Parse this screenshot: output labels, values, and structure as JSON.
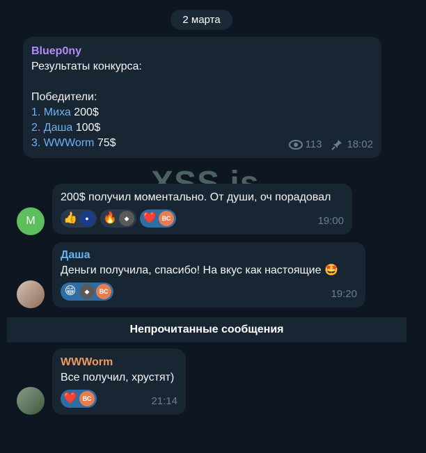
{
  "date_pill": "2 марта",
  "watermark": "XSS.is",
  "channel_post": {
    "author": "Bluep0ny",
    "line1": "Результаты конкурса:",
    "line2": "Победители:",
    "winners": [
      {
        "num": "1.",
        "name": "Миха",
        "amount": "200$"
      },
      {
        "num": "2.",
        "name": "Даша",
        "amount": "100$"
      },
      {
        "num": "3.",
        "name": "WWWorm",
        "amount": "75$"
      }
    ],
    "views": "113",
    "time": "18:02"
  },
  "message1": {
    "avatar_letter": "M",
    "text": "200$ получил моментально. От души, оч порадовал",
    "reactions": [
      "👍",
      "🔥",
      "❤️"
    ],
    "mini_avatar_label": "ВС",
    "time": "19:00"
  },
  "message2": {
    "author": "Даша ",
    "text": "Деньги получила, спасибо!  На вкус как настоящие 🤩",
    "reactions": [
      "😁"
    ],
    "mini_avatar_label": "ВС",
    "time": "19:20"
  },
  "unread_label": "Непрочитанные сообщения",
  "message3": {
    "author": "WWWorm",
    "text": "Все получил, хрустят)",
    "reactions": [
      "❤️"
    ],
    "mini_avatar_label": "ВС",
    "time": "21:14"
  },
  "colors": {
    "background": "#0e1621",
    "bubble": "#182533",
    "link": "#6ab3f3",
    "author_purple": "#b18cf7",
    "author_orange": "#ef9a5b",
    "reaction_active": "#2f6ea5"
  }
}
